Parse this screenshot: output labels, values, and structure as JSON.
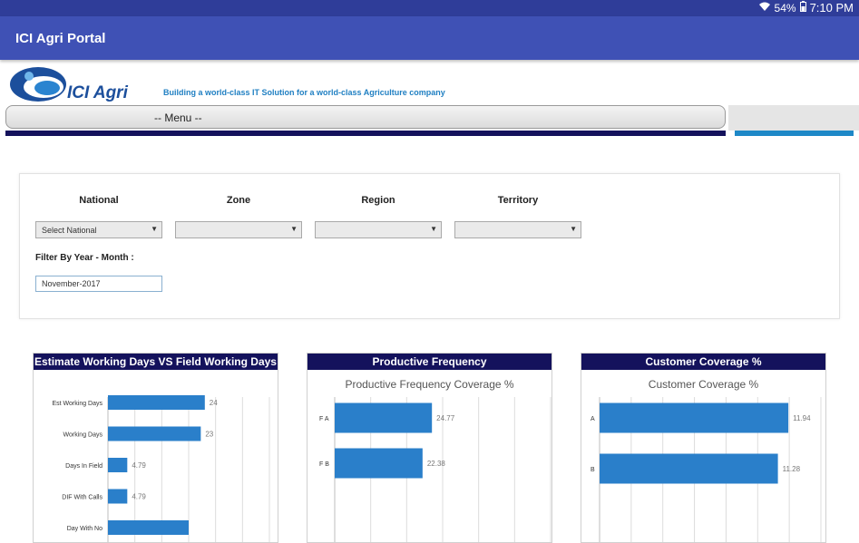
{
  "status_bar": {
    "battery": "54%",
    "time": "7:10 PM"
  },
  "app_bar": {
    "title": "ICI Agri Portal"
  },
  "brand": {
    "logo_text": "ICI Agri",
    "tagline": "Building a world-class IT Solution for a world-class Agriculture company"
  },
  "menu": {
    "label": "-- Menu --"
  },
  "filters": {
    "national": {
      "label": "National",
      "value": "Select National"
    },
    "zone": {
      "label": "Zone",
      "value": ""
    },
    "region": {
      "label": "Region",
      "value": ""
    },
    "territory": {
      "label": "Territory",
      "value": ""
    },
    "year_month": {
      "label": "Filter By Year - Month :",
      "value": "November-2017"
    }
  },
  "chart_data": [
    {
      "type": "bar",
      "orientation": "horizontal",
      "title": "Estimate Working Days VS Field Working Days",
      "subtitle": "",
      "categories": [
        "Est Working Days",
        "Working Days",
        "Days In Field",
        "DIF With Calls",
        "Day With No"
      ],
      "values": [
        24,
        23,
        4.79,
        4.79,
        20
      ],
      "value_labels": [
        "24",
        "23",
        "4.79",
        "4.79",
        ""
      ],
      "xlim": [
        0,
        40
      ],
      "grid": true,
      "color": "#2a7fca"
    },
    {
      "type": "bar",
      "orientation": "horizontal",
      "title": "Productive Frequency",
      "subtitle": "Productive Frequency Coverage %",
      "categories": [
        "F A",
        "F B"
      ],
      "values": [
        24.77,
        22.38
      ],
      "value_labels": [
        "24.77",
        "22.38"
      ],
      "xlim": [
        0,
        55
      ],
      "grid": true,
      "color": "#2a7fca"
    },
    {
      "type": "bar",
      "orientation": "horizontal",
      "title": "Customer Coverage %",
      "subtitle": "Customer Coverage %",
      "categories": [
        "A",
        "B"
      ],
      "values": [
        11.94,
        11.28
      ],
      "value_labels": [
        "11.94",
        "11.28"
      ],
      "xlim": [
        0,
        14
      ],
      "grid": true,
      "color": "#2a7fca"
    }
  ]
}
